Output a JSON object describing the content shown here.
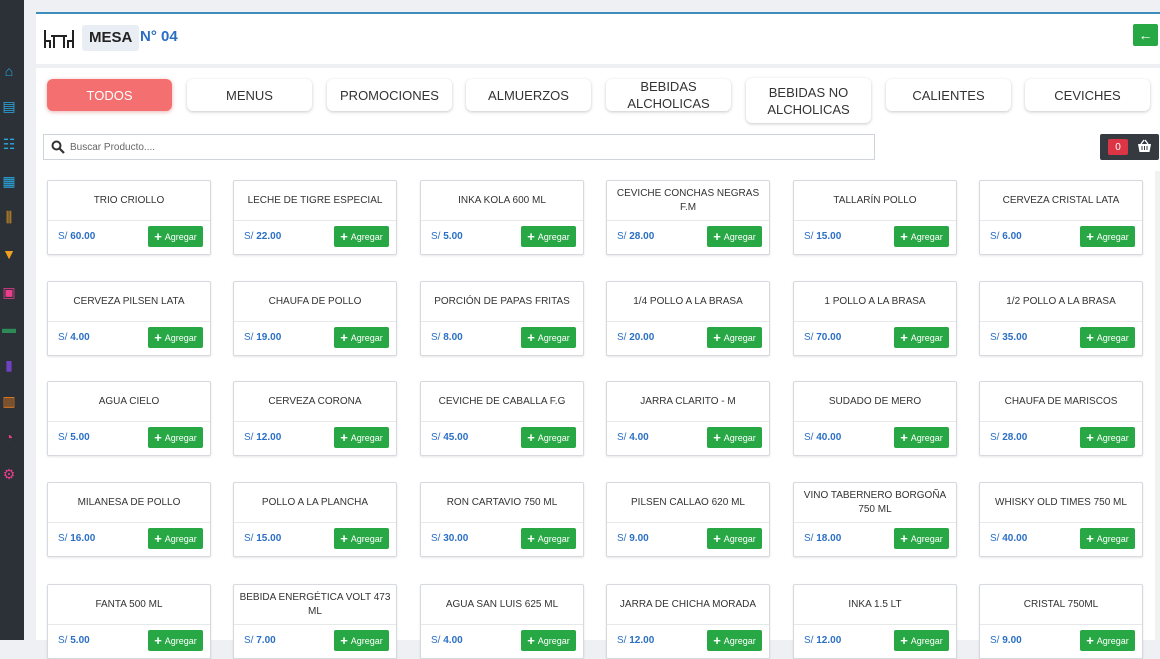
{
  "sidebar": {
    "icons": [
      "home-icon",
      "folder-open-icon",
      "sitemap-icon",
      "cash-register-icon",
      "utensils-icon",
      "shopping-cart-icon",
      "users-icon",
      "money-icon",
      "file-icon",
      "file-invoice-icon",
      "pie-chart-icon",
      "gear-icon"
    ],
    "colors": [
      "#2aa8e0",
      "#2aa8e0",
      "#2aa8e0",
      "#2aa8e0",
      "#f0a020",
      "#f0a020",
      "#e83e8c",
      "#2e8b57",
      "#6f42c1",
      "#f08020",
      "#e83e8c",
      "#e83e8c"
    ]
  },
  "header": {
    "mesa_label": "MESA",
    "mesa_number": "N° 04",
    "back_icon": "arrow-left-icon"
  },
  "categories": [
    {
      "label": "TODOS",
      "active": true
    },
    {
      "label": "MENUS",
      "active": false
    },
    {
      "label": "PROMOCIONES",
      "active": false
    },
    {
      "label": "ALMUERZOS",
      "active": false
    },
    {
      "label": "BEBIDAS ALCHOLICAS",
      "active": false
    },
    {
      "label": "BEBIDAS NO ALCHOLICAS",
      "active": false
    },
    {
      "label": "CALIENTES",
      "active": false
    },
    {
      "label": "CEVICHES",
      "active": false
    }
  ],
  "search": {
    "placeholder": "Buscar Producto...."
  },
  "cart": {
    "count": "0"
  },
  "currency": "S/",
  "add_label": "Agregar",
  "products": [
    {
      "name": "TRIO CRIOLLO",
      "price": "60.00"
    },
    {
      "name": "LECHE DE TIGRE ESPECIAL",
      "price": "22.00"
    },
    {
      "name": "INKA KOLA 600 ML",
      "price": "5.00"
    },
    {
      "name": "CEVICHE CONCHAS NEGRAS F.M",
      "price": "28.00"
    },
    {
      "name": "TALLARÍN POLLO",
      "price": "15.00"
    },
    {
      "name": "CERVEZA CRISTAL LATA",
      "price": "6.00"
    },
    {
      "name": "CERVEZA PILSEN LATA",
      "price": "4.00"
    },
    {
      "name": "CHAUFA DE POLLO",
      "price": "19.00"
    },
    {
      "name": "PORCIÓN DE PAPAS FRITAS",
      "price": "8.00"
    },
    {
      "name": "1/4 POLLO A LA BRASA",
      "price": "20.00"
    },
    {
      "name": "1 POLLO A LA BRASA",
      "price": "70.00"
    },
    {
      "name": "1/2 POLLO A LA BRASA",
      "price": "35.00"
    },
    {
      "name": "AGUA CIELO",
      "price": "5.00"
    },
    {
      "name": "CERVEZA CORONA",
      "price": "12.00"
    },
    {
      "name": "CEVICHE DE CABALLA F.G",
      "price": "45.00"
    },
    {
      "name": "JARRA CLARITO - M",
      "price": "4.00"
    },
    {
      "name": "SUDADO DE MERO",
      "price": "40.00"
    },
    {
      "name": "CHAUFA DE MARISCOS",
      "price": "28.00"
    },
    {
      "name": "MILANESA DE POLLO",
      "price": "16.00"
    },
    {
      "name": "POLLO A LA PLANCHA",
      "price": "15.00"
    },
    {
      "name": "RON CARTAVIO 750 ML",
      "price": "30.00"
    },
    {
      "name": "PILSEN CALLAO 620 ML",
      "price": "9.00"
    },
    {
      "name": "VINO TABERNERO BORGOÑA 750 ML",
      "price": "18.00"
    },
    {
      "name": "WHISKY OLD TIMES 750 ML",
      "price": "40.00"
    },
    {
      "name": "FANTA 500 ML",
      "price": "5.00"
    },
    {
      "name": "BEBIDA ENERGÉTICA VOLT 473 ML",
      "price": "7.00"
    },
    {
      "name": "AGUA SAN LUIS 625 ML",
      "price": "4.00"
    },
    {
      "name": "JARRA DE CHICHA MORADA",
      "price": "12.00"
    },
    {
      "name": "INKA 1.5 LT",
      "price": "12.00"
    },
    {
      "name": "CRISTAL 750ML",
      "price": "9.00"
    }
  ]
}
